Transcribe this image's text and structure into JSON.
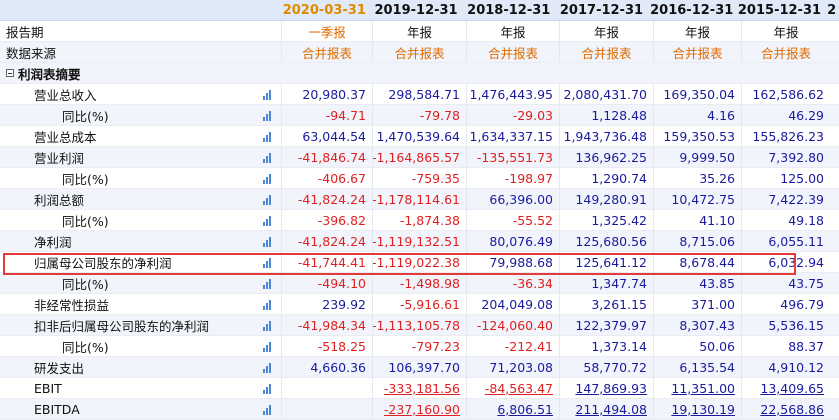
{
  "header": {
    "corner": "",
    "periods": [
      "2020-03-31",
      "2019-12-31",
      "2018-12-31",
      "2017-12-31",
      "2016-12-31",
      "2015-12-31"
    ],
    "overflow": "2"
  },
  "meta_rows": [
    {
      "label": "报告期",
      "values": [
        "一季报",
        "年报",
        "年报",
        "年报",
        "年报",
        "年报"
      ]
    },
    {
      "label": "数据来源",
      "values": [
        "合并报表",
        "合并报表",
        "合并报表",
        "合并报表",
        "合并报表",
        "合并报表"
      ]
    }
  ],
  "section": {
    "label": "利润表摘要"
  },
  "rows": [
    {
      "label": "营业总收入",
      "level": 1,
      "icon": true,
      "values": [
        "20,980.37",
        "298,584.71",
        "1,476,443.95",
        "2,080,431.70",
        "169,350.04",
        "162,586.62"
      ],
      "neg": [
        false,
        false,
        false,
        false,
        false,
        false
      ]
    },
    {
      "label": "同比(%)",
      "level": 2,
      "icon": true,
      "values": [
        "-94.71",
        "-79.78",
        "-29.03",
        "1,128.48",
        "4.16",
        "46.29"
      ],
      "neg": [
        true,
        true,
        true,
        false,
        false,
        false
      ]
    },
    {
      "label": "营业总成本",
      "level": 1,
      "icon": true,
      "values": [
        "63,044.54",
        "1,470,539.64",
        "1,634,337.15",
        "1,943,736.48",
        "159,350.53",
        "155,826.23"
      ],
      "neg": [
        false,
        false,
        false,
        false,
        false,
        false
      ]
    },
    {
      "label": "营业利润",
      "level": 1,
      "icon": true,
      "values": [
        "-41,846.74",
        "-1,164,865.57",
        "-135,551.73",
        "136,962.25",
        "9,999.50",
        "7,392.80"
      ],
      "neg": [
        true,
        true,
        true,
        false,
        false,
        false
      ]
    },
    {
      "label": "同比(%)",
      "level": 2,
      "icon": true,
      "values": [
        "-406.67",
        "-759.35",
        "-198.97",
        "1,290.74",
        "35.26",
        "125.00"
      ],
      "neg": [
        true,
        true,
        true,
        false,
        false,
        false
      ]
    },
    {
      "label": "利润总额",
      "level": 1,
      "icon": true,
      "values": [
        "-41,824.24",
        "-1,178,114.61",
        "66,396.00",
        "149,280.91",
        "10,472.75",
        "7,422.39"
      ],
      "neg": [
        true,
        true,
        false,
        false,
        false,
        false
      ]
    },
    {
      "label": "同比(%)",
      "level": 2,
      "icon": true,
      "values": [
        "-396.82",
        "-1,874.38",
        "-55.52",
        "1,325.42",
        "41.10",
        "49.18"
      ],
      "neg": [
        true,
        true,
        true,
        false,
        false,
        false
      ]
    },
    {
      "label": "净利润",
      "level": 1,
      "icon": true,
      "values": [
        "-41,824.24",
        "-1,119,132.51",
        "80,076.49",
        "125,680.56",
        "8,715.06",
        "6,055.11"
      ],
      "neg": [
        true,
        true,
        false,
        false,
        false,
        false
      ]
    },
    {
      "label": "归属母公司股东的净利润",
      "level": 1,
      "icon": true,
      "values": [
        "-41,744.41",
        "-1,119,022.38",
        "79,988.68",
        "125,641.12",
        "8,678.44",
        "6,032.94"
      ],
      "neg": [
        true,
        true,
        false,
        false,
        false,
        false
      ],
      "highlight": true
    },
    {
      "label": "同比(%)",
      "level": 2,
      "icon": true,
      "values": [
        "-494.10",
        "-1,498.98",
        "-36.34",
        "1,347.74",
        "43.85",
        "43.75"
      ],
      "neg": [
        true,
        true,
        true,
        false,
        false,
        false
      ]
    },
    {
      "label": "非经常性损益",
      "level": 1,
      "icon": true,
      "values": [
        "239.92",
        "-5,916.61",
        "204,049.08",
        "3,261.15",
        "371.00",
        "496.79"
      ],
      "neg": [
        false,
        true,
        false,
        false,
        false,
        false
      ]
    },
    {
      "label": "扣非后归属母公司股东的净利润",
      "level": 1,
      "icon": true,
      "values": [
        "-41,984.34",
        "-1,113,105.78",
        "-124,060.40",
        "122,379.97",
        "8,307.43",
        "5,536.15"
      ],
      "neg": [
        true,
        true,
        true,
        false,
        false,
        false
      ]
    },
    {
      "label": "同比(%)",
      "level": 2,
      "icon": true,
      "values": [
        "-518.25",
        "-797.23",
        "-212.41",
        "1,373.14",
        "50.06",
        "88.37"
      ],
      "neg": [
        true,
        true,
        true,
        false,
        false,
        false
      ]
    },
    {
      "label": "研发支出",
      "level": 1,
      "icon": true,
      "values": [
        "4,660.36",
        "106,397.70",
        "71,203.08",
        "58,770.72",
        "6,135.54",
        "4,910.12"
      ],
      "neg": [
        false,
        false,
        false,
        false,
        false,
        false
      ]
    },
    {
      "label": "EBIT",
      "level": 1,
      "icon": true,
      "values": [
        "",
        "-333,181.56",
        "-84,563.47",
        "147,869.93",
        "11,351.00",
        "13,409.65"
      ],
      "neg": [
        false,
        true,
        true,
        false,
        false,
        false
      ],
      "underline": true
    },
    {
      "label": "EBITDA",
      "level": 1,
      "icon": true,
      "values": [
        "",
        "-237,160.90",
        "6,806.51",
        "211,494.08",
        "19,130.19",
        "22,568.86"
      ],
      "neg": [
        false,
        true,
        false,
        false,
        false,
        false
      ],
      "underline": true
    }
  ],
  "colors": {
    "header_bg": "#dfe9f7",
    "alt_row_bg": "#f1f5fb",
    "negative": "#e02020",
    "positive": "#1a1a9e",
    "highlight_border": "#e33a3a",
    "current_period": "#e08a00"
  }
}
